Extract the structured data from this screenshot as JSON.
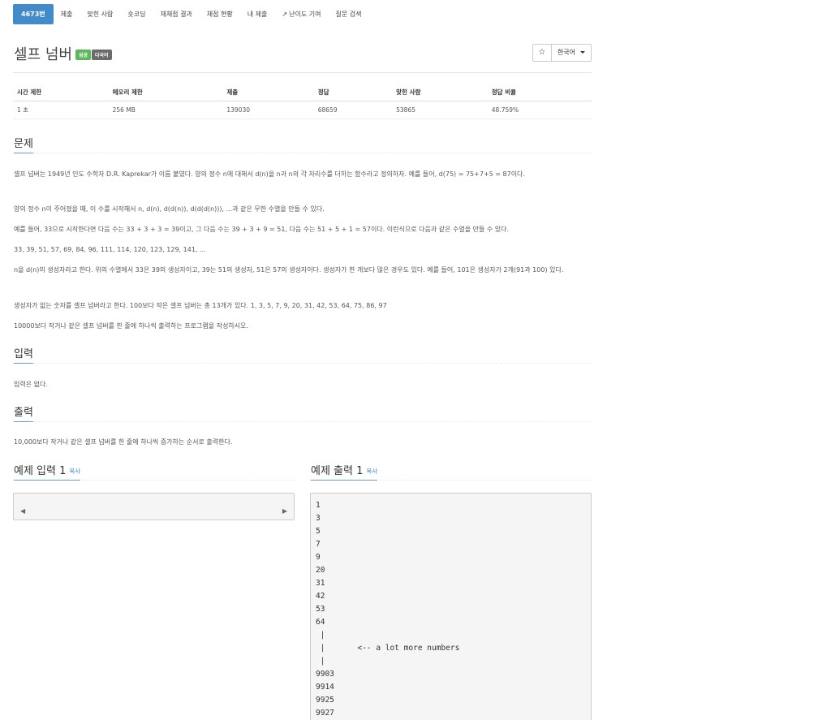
{
  "tabs": [
    {
      "label": "4673번",
      "active": true
    },
    {
      "label": "제출"
    },
    {
      "label": "맞힌 사람"
    },
    {
      "label": "숏코딩"
    },
    {
      "label": "재채점 결과"
    },
    {
      "label": "채점 현황"
    },
    {
      "label": "내 제출"
    },
    {
      "label": "난이도 기여"
    },
    {
      "label": "질문 검색"
    }
  ],
  "problem": {
    "title": "셀프 넘버",
    "badge_success": "성공",
    "badge_multi": "다국어",
    "star": "☆",
    "language": "한국어"
  },
  "info_table": {
    "headers": [
      "시간 제한",
      "메모리 제한",
      "제출",
      "정답",
      "맞힌 사람",
      "정답 비율"
    ],
    "values": [
      "1 초",
      "256 MB",
      "139030",
      "68659",
      "53865",
      "48.759%"
    ]
  },
  "sections": {
    "problem": "문제",
    "input": "입력",
    "output": "출력",
    "sample_input": "예제 입력 1",
    "sample_output": "예제 출력 1",
    "copy": "복사"
  },
  "problem_text": [
    "셀프 넘버는 1949년 인도 수학자 D.R. Kaprekar가 이름 붙였다. 양의 정수 n에 대해서 d(n)을 n과 n의 각 자리수를 더하는 함수라고 정의하자. 예를 들어, d(75) = 75+7+5 = 87이다.",
    "양의 정수 n이 주어졌을 때, 이 수를 시작해서 n, d(n), d(d(n)), d(d(d(n))), ...과 같은 무한 수열을 만들 수 있다.",
    "예를 들어, 33으로 시작한다면 다음 수는 33 + 3 + 3 = 39이고, 그 다음 수는 39 + 3 + 9 = 51, 다음 수는 51 + 5 + 1 = 57이다. 이런식으로 다음과 같은 수열을 만들 수 있다.",
    "33, 39, 51, 57, 69, 84, 96, 111, 114, 120, 123, 129, 141, ...",
    "n을 d(n)의 생성자라고 한다. 위의 수열에서 33은 39의 생성자이고, 39는 51의 생성자, 51은 57의 생성자이다. 생성자가 한 개보다 많은 경우도 있다. 예를 들어, 101은 생성자가 2개(91과 100) 있다.",
    "생성자가 없는 숫자를 셀프 넘버라고 한다. 100보다 작은 셀프 넘버는 총 13개가 있다. 1, 3, 5, 7, 9, 20, 31, 42, 53, 64, 75, 86, 97",
    "10000보다 작거나 같은 셀프 넘버를 한 줄에 하나씩 출력하는 프로그램을 작성하시오."
  ],
  "input_text": "입력은 없다.",
  "output_text": "10,000보다 작거나 같은 셀프 넘버를 한 줄에 하나씩 증가하는 순서로 출력한다.",
  "sample_output_text": "1\n3\n5\n7\n9\n20\n31\n42\n53\n64\n |\n |       <-- a lot more numbers\n |\n9903\n9914\n9925\n9927"
}
